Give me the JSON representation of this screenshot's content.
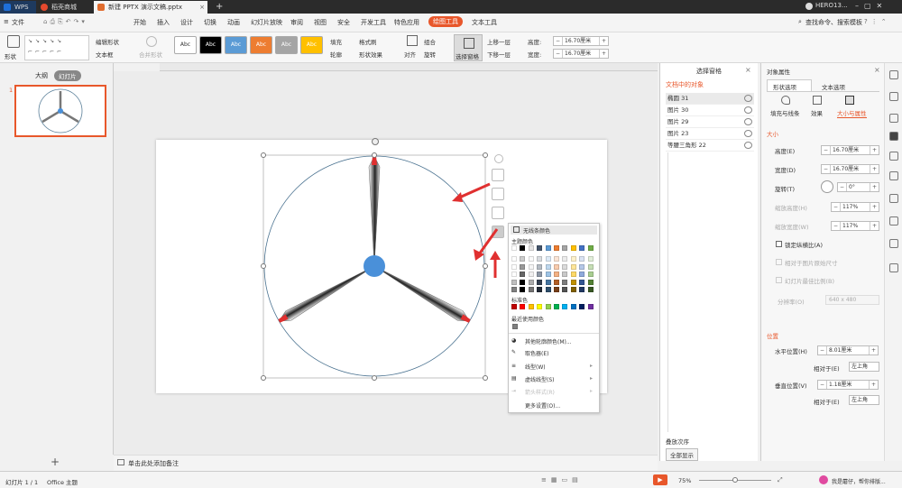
{
  "titlebar": {
    "tabs": [
      {
        "label": "WPS",
        "color": "#1e6fd9"
      },
      {
        "label": "稻壳商城",
        "color": "#e6492d"
      },
      {
        "label": "新建 PPTX 演示文稿.pptx",
        "color": "#e06c2e"
      }
    ],
    "add_tab": "+",
    "user": "HERO13..."
  },
  "menubar": {
    "file": "文件",
    "items": [
      "开始",
      "插入",
      "设计",
      "切换",
      "动画",
      "幻灯片放映",
      "审阅",
      "视图",
      "安全",
      "开发工具",
      "特色应用",
      "绘图工具",
      "文本工具"
    ],
    "active": "绘图工具",
    "search": "查找命令、搜索模板"
  },
  "ribbon": {
    "shape_label": "形状",
    "edit_shape": "编辑形状",
    "textbox": "文本框",
    "merge_shape": "合并形状",
    "style_labels": [
      "Abc",
      "Abc",
      "Abc",
      "Abc",
      "Abc",
      "Abc"
    ],
    "style_colors": [
      "#ffffff",
      "#000000",
      "#5b9bd5",
      "#ed7d31",
      "#a5a5a5",
      "#ffc000"
    ],
    "fill": "填充",
    "format_painter": "格式刷",
    "outline": "轮廓",
    "shape_effect": "形状效果",
    "align": "对齐",
    "group": "组合",
    "rotate": "旋转",
    "selection_pane": "选择窗格",
    "bring_forward": "上移一层",
    "send_backward": "下移一层",
    "height_label": "高度:",
    "height_value": "16.70厘米",
    "width_label": "宽度:",
    "width_value": "16.70厘米"
  },
  "left_panel": {
    "tab_outline": "大纲",
    "tab_slides": "幻灯片",
    "slide_number": "1",
    "add_slide": "+"
  },
  "selection_pane": {
    "title": "选择窗格",
    "objects_title": "文档中的对象",
    "objects": [
      "椭圆 31",
      "图片 30",
      "图片 29",
      "图片 23",
      "等腰三角形 22"
    ],
    "order_label": "叠放次序",
    "show_all": "全部显示"
  },
  "color_menu": {
    "no_line": "无线条颜色",
    "theme_colors": "主题颜色",
    "standard_colors": "标准色",
    "recent_colors": "最近使用颜色",
    "more_colors": "其他轮廓颜色(M)...",
    "eyedropper": "取色器(E)",
    "line_type": "线型(W)",
    "dash_type": "虚线线型(S)",
    "arrow_style": "箭头样式(R)",
    "more_settings": "更多设置(O)...",
    "theme_row": [
      "#ffffff",
      "#000000",
      "#e7e6e6",
      "#44546a",
      "#5b9bd5",
      "#ed7d31",
      "#a5a5a5",
      "#ffc000",
      "#4472c4",
      "#70ad47"
    ],
    "standard_row": [
      "#c00000",
      "#ff0000",
      "#ffc000",
      "#ffff00",
      "#92d050",
      "#00b050",
      "#00b0f0",
      "#0070c0",
      "#002060",
      "#7030a0"
    ],
    "recent_row": [
      "#7f7f7f"
    ]
  },
  "properties": {
    "title": "对象属性",
    "tab_shape": "形状选项",
    "tab_text": "文本选项",
    "sub_fill": "填充与线条",
    "sub_effect": "效果",
    "sub_size": "大小与属性",
    "size_section": "大小",
    "height_label": "高度(E)",
    "height_value": "16.70厘米",
    "width_label": "宽度(D)",
    "width_value": "16.70厘米",
    "rotate_label": "旋转(T)",
    "rotate_value": "0°",
    "scale_h_label": "缩放高度(H)",
    "scale_h_value": "117%",
    "scale_w_label": "缩放宽度(W)",
    "scale_w_value": "117%",
    "lock_ratio": "锁定纵横比(A)",
    "relative_original": "相对于图片原始尺寸",
    "best_scale": "幻灯片最佳比例(B)",
    "resolution_label": "分辨率(O)",
    "resolution_value": "640 x 480",
    "position_section": "位置",
    "hpos_label": "水平位置(H)",
    "hpos_value": "8.01厘米",
    "hrel_label": "相对于(E)",
    "hrel_value": "左上角",
    "vpos_label": "垂直位置(V)",
    "vpos_value": "1.18厘米",
    "vrel_label": "相对于(E)",
    "vrel_value": "左上角"
  },
  "notes": {
    "placeholder": "单击此处添加备注"
  },
  "statusbar": {
    "slide_info": "幻灯片 1 / 1",
    "theme": "Office 主题",
    "zoom": "75%",
    "assistant": "我是蘑仔，帮你排版..."
  }
}
